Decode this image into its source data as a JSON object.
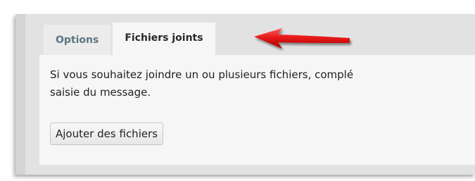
{
  "tabs": {
    "options_label": "Options",
    "fichiers_label": "Fichiers joints"
  },
  "panel": {
    "line1": "Si vous souhaitez joindre un ou plusieurs fichiers, complé",
    "line2": "saisie du message.",
    "add_button_label": "Ajouter des fichiers"
  },
  "colors": {
    "arrow": "#e31414",
    "inactive_tab_text": "#5f7584",
    "active_tab_bg": "#f6f6f6"
  },
  "annotation": {
    "icon": "red-arrow-icon"
  }
}
